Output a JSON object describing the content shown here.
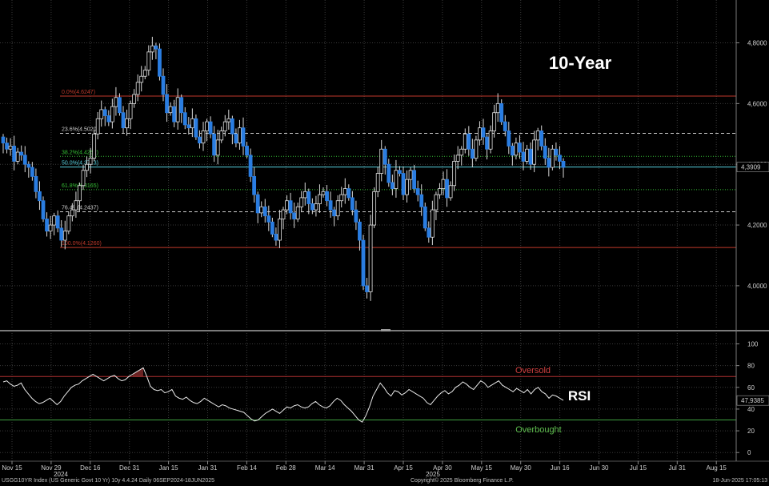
{
  "chart_data": [
    {
      "type": "candlestick",
      "title": "10-Year",
      "y_ticks": [
        "4,8000",
        "4,6000",
        "4,4000",
        "4,2000",
        "4,0000"
      ],
      "ylim": [
        3.86,
        4.92
      ],
      "last_value": 4.3909,
      "last_value_label": "4,3909",
      "fib_levels": [
        {
          "label": "0.0%(4.6247)",
          "value": 4.6247,
          "color": "#c0392b",
          "line": "solid"
        },
        {
          "label": "23.6%(4.5020)",
          "value": 4.502,
          "color": "#cfcfcf",
          "line": "dashed"
        },
        {
          "label": "38.2%(4.4262)",
          "value": 4.4262,
          "color": "#35c035",
          "line": "dotted"
        },
        {
          "label": "50.0%(4.3713)",
          "value": 4.3909,
          "color": "#57d0df",
          "line": "solid"
        },
        {
          "label": "61.8%(4.3165)",
          "value": 4.3165,
          "color": "#35c035",
          "line": "dotted"
        },
        {
          "label": "76.4%(4.2437)",
          "value": 4.2437,
          "color": "#cfcfcf",
          "line": "dashed"
        },
        {
          "label": "100.0%(4.1260)",
          "value": 4.126,
          "color": "#c0392b",
          "line": "solid"
        }
      ],
      "x_ticks": [
        "Nov 15",
        "Nov 29",
        "Dec 16",
        "Dec 31",
        "Jan 15",
        "Jan 31",
        "Feb 14",
        "Feb 28",
        "Mar 14",
        "Mar 31",
        "Apr 15",
        "Apr 30",
        "May 15",
        "May 30",
        "Jun 16",
        "Jun 30",
        "Jul 15",
        "Jul 31",
        "Aug 15"
      ],
      "year_labels": [
        "2024",
        "2025"
      ],
      "closes": [
        4.47,
        4.45,
        4.46,
        4.41,
        4.44,
        4.43,
        4.4,
        4.39,
        4.36,
        4.31,
        4.28,
        4.22,
        4.18,
        4.2,
        4.23,
        4.19,
        4.15,
        4.18,
        4.23,
        4.25,
        4.28,
        4.33,
        4.38,
        4.4,
        4.42,
        4.5,
        4.55,
        4.58,
        4.56,
        4.54,
        4.59,
        4.62,
        4.57,
        4.52,
        4.55,
        4.6,
        4.63,
        4.67,
        4.69,
        4.71,
        4.77,
        4.79,
        4.78,
        4.69,
        4.63,
        4.57,
        4.59,
        4.54,
        4.62,
        4.57,
        4.53,
        4.52,
        4.55,
        4.49,
        4.47,
        4.51,
        4.54,
        4.5,
        4.43,
        4.48,
        4.51,
        4.54,
        4.55,
        4.5,
        4.47,
        4.52,
        4.46,
        4.43,
        4.36,
        4.3,
        4.24,
        4.26,
        4.23,
        4.21,
        4.17,
        4.15,
        4.22,
        4.25,
        4.28,
        4.24,
        4.22,
        4.26,
        4.29,
        4.31,
        4.27,
        4.25,
        4.27,
        4.3,
        4.31,
        4.28,
        4.25,
        4.23,
        4.28,
        4.3,
        4.32,
        4.29,
        4.25,
        4.21,
        4.15,
        4.0,
        3.98,
        4.2,
        4.31,
        4.37,
        4.45,
        4.4,
        4.34,
        4.32,
        4.38,
        4.37,
        4.3,
        4.35,
        4.38,
        4.32,
        4.3,
        4.26,
        4.19,
        4.16,
        4.25,
        4.3,
        4.32,
        4.35,
        4.29,
        4.33,
        4.41,
        4.43,
        4.45,
        4.5,
        4.45,
        4.42,
        4.48,
        4.52,
        4.49,
        4.45,
        4.51,
        4.57,
        4.6,
        4.54,
        4.51,
        4.46,
        4.43,
        4.47,
        4.44,
        4.41,
        4.45,
        4.4,
        4.48,
        4.51,
        4.46,
        4.42,
        4.39,
        4.45,
        4.43,
        4.41,
        4.39
      ]
    },
    {
      "type": "line",
      "title": "RSI",
      "y_ticks": [
        "100",
        "80",
        "60",
        "40",
        "20",
        "0"
      ],
      "ylim": [
        -5,
        107
      ],
      "last_value": 47.9385,
      "last_value_label": "47,9385",
      "oversold_label": "Oversold",
      "overbought_label": "Overbought",
      "oversold_level": 70,
      "overbought_level": 30,
      "values": [
        65,
        66,
        63,
        61,
        62,
        64,
        58,
        54,
        50,
        47,
        45,
        46,
        48,
        50,
        47,
        44,
        47,
        52,
        56,
        60,
        62,
        63,
        66,
        68,
        70,
        72,
        70,
        68,
        66,
        68,
        70,
        71,
        68,
        66,
        67,
        70,
        72,
        74,
        76,
        78,
        70,
        61,
        58,
        57,
        58,
        55,
        56,
        58,
        52,
        50,
        49,
        51,
        48,
        46,
        45,
        47,
        50,
        48,
        46,
        44,
        42,
        44,
        43,
        41,
        40,
        39,
        38,
        37,
        34,
        31,
        29,
        30,
        33,
        36,
        38,
        40,
        38,
        36,
        39,
        42,
        41,
        43,
        44,
        42,
        41,
        42,
        45,
        47,
        44,
        42,
        41,
        43,
        47,
        50,
        48,
        44,
        41,
        38,
        34,
        30,
        28,
        34,
        42,
        52,
        58,
        64,
        60,
        55,
        52,
        57,
        56,
        53,
        55,
        58,
        56,
        54,
        52,
        50,
        46,
        44,
        48,
        52,
        55,
        57,
        54,
        56,
        60,
        62,
        65,
        63,
        60,
        58,
        62,
        66,
        64,
        60,
        62,
        64,
        66,
        62,
        60,
        58,
        56,
        59,
        57,
        55,
        58,
        54,
        58,
        60,
        56,
        54,
        50,
        53,
        52,
        50,
        48
      ]
    }
  ],
  "footer": {
    "left": "USGG10YR Index (US Generic Govt 10 Yr) 10y 4.4.24  Daily 06SEP2024-18JUN2025",
    "center": "Copyright© 2025 Bloomberg Finance L.P.",
    "right": "18-Jun-2025 17:05:13"
  }
}
